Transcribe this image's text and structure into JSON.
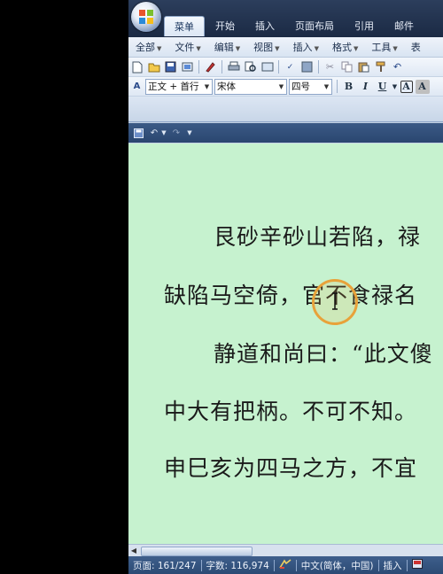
{
  "ribbon": {
    "tabs": [
      "菜单",
      "开始",
      "插入",
      "页面布局",
      "引用",
      "邮件"
    ]
  },
  "menubar": {
    "items": [
      "全部",
      "文件",
      "编辑",
      "视图",
      "插入",
      "格式",
      "工具",
      "表"
    ]
  },
  "format_toolbar": {
    "style": "正文 + 首行",
    "font": "宋体",
    "size": "四号",
    "bold": "B",
    "italic": "I",
    "underline": "U",
    "char_border": "A",
    "char_shading": "A"
  },
  "document": {
    "lines": [
      "艮砂辛砂山若陷，禄",
      "缺陷马空倚，官不食禄名",
      "静道和尚曰：“此文傻",
      "中大有把柄。不可不知。",
      "申巳亥为四马之方，不宜"
    ]
  },
  "status": {
    "page": "页面: 161/247",
    "words": "字数: 116,974",
    "language": "中文(简体，中国)",
    "mode": "插入"
  },
  "colors": {
    "document_background": "#c6f2cf",
    "ribbon_dark": "#2c3e5c",
    "cursor_highlight": "#e8a23a"
  }
}
